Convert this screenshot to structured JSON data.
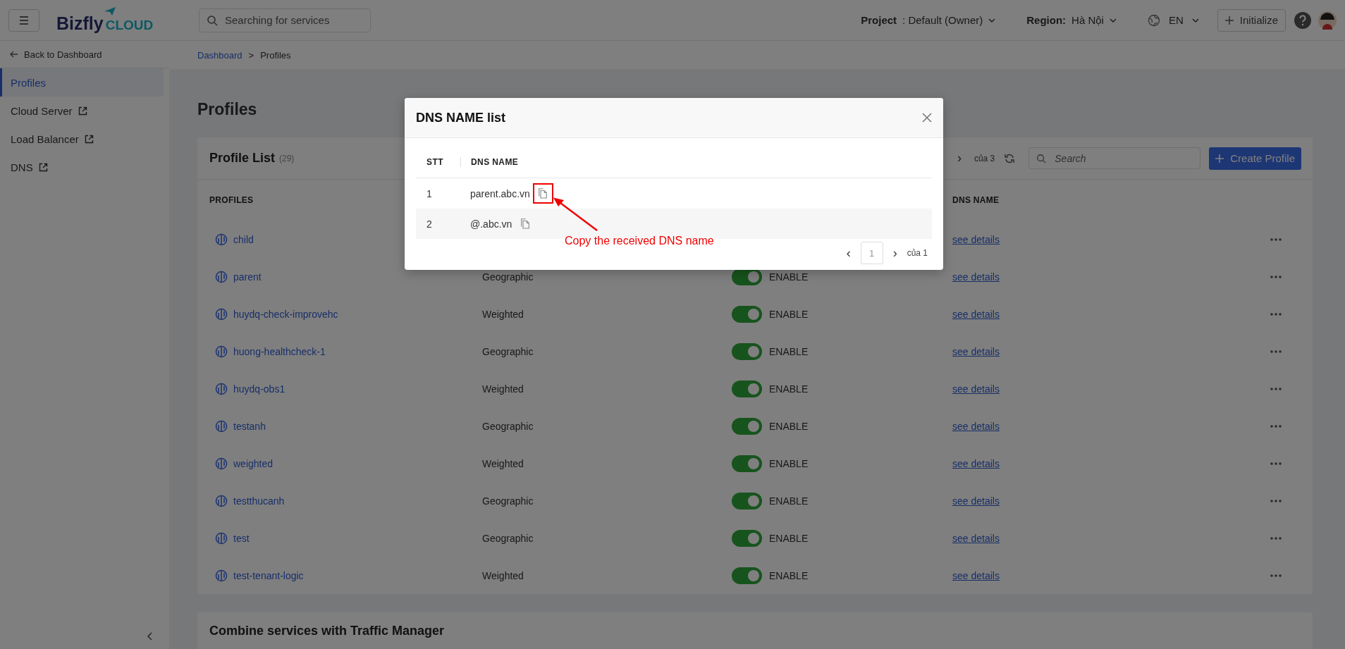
{
  "topbar": {
    "logo": {
      "brand": "Bizfly",
      "suffix": "CLOUD"
    },
    "search": {
      "placeholder": "Searching for services"
    },
    "project": {
      "label": "Project",
      "value": " : Default (Owner)"
    },
    "region": {
      "label": "Region:",
      "value": " Hà Nội"
    },
    "language": "EN",
    "initialize_button": "Initialize"
  },
  "sidebar": {
    "back_link": "Back to Dashboard",
    "items": [
      {
        "label": "Profiles",
        "selected": true,
        "external": false
      },
      {
        "label": "Cloud Server",
        "selected": false,
        "external": true
      },
      {
        "label": "Load Balancer",
        "selected": false,
        "external": true
      },
      {
        "label": "DNS",
        "selected": false,
        "external": true
      }
    ]
  },
  "breadcrumb": {
    "separator": ">",
    "items": [
      "Dashboard",
      "Profiles"
    ]
  },
  "page_title": "Profiles",
  "profile_list": {
    "title": "Profile List",
    "count": "(29)",
    "pagination": {
      "next": "›",
      "total": "của 3"
    },
    "search": {
      "placeholder": "Search"
    },
    "create_button": "Create Profile"
  },
  "table": {
    "columns": [
      "PROFILES",
      "DNS NAME"
    ],
    "rows": [
      {
        "name": "child",
        "link": "see details"
      },
      {
        "name": "parent",
        "type": "Geographic",
        "status": {
          "on": true,
          "label": "ENABLE"
        },
        "link": "see details"
      },
      {
        "name": "huydq-check-improvehc",
        "type": "Weighted",
        "status": {
          "on": true,
          "label": "ENABLE"
        },
        "link": "see details"
      },
      {
        "name": "huong-healthcheck-1",
        "type": "Geographic",
        "status": {
          "on": true,
          "label": "ENABLE"
        },
        "link": "see details"
      },
      {
        "name": "huydq-obs1",
        "type": "Weighted",
        "status": {
          "on": true,
          "label": "ENABLE"
        },
        "link": "see details"
      },
      {
        "name": "testanh",
        "type": "Geographic",
        "status": {
          "on": true,
          "label": "ENABLE"
        },
        "link": "see details"
      },
      {
        "name": "weighted",
        "type": "Weighted",
        "status": {
          "on": true,
          "label": "ENABLE"
        },
        "link": "see details"
      },
      {
        "name": "testthucanh",
        "type": "Geographic",
        "status": {
          "on": true,
          "label": "ENABLE"
        },
        "link": "see details"
      },
      {
        "name": "test",
        "type": "Geographic",
        "status": {
          "on": true,
          "label": "ENABLE"
        },
        "link": "see details"
      },
      {
        "name": "test-tenant-logic",
        "type": "Weighted",
        "status": {
          "on": true,
          "label": "ENABLE"
        },
        "link": "see details"
      }
    ]
  },
  "combine_section": {
    "title": "Combine services with Traffic Manager"
  },
  "dialog": {
    "title": "DNS NAME list",
    "columns": [
      "STT",
      "DNS NAME"
    ],
    "rows": [
      {
        "index": "1",
        "dns_name": "parent.abc.vn",
        "highlighted": true
      },
      {
        "index": "2",
        "dns_name": "@.abc.vn",
        "highlighted": false
      }
    ],
    "pagination": {
      "prev": "‹",
      "page": "1",
      "next": "›",
      "total": "của 1"
    },
    "annotation": "Copy the received DNS name"
  }
}
